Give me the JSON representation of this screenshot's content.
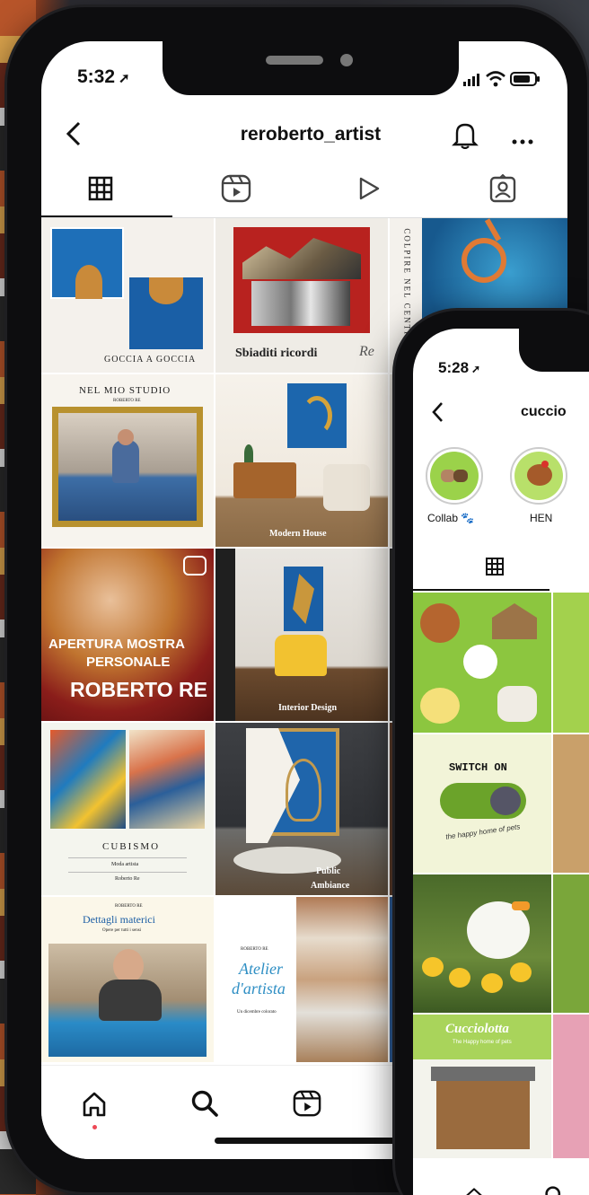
{
  "phone1": {
    "time": "5:32",
    "username": "reroberto_artist",
    "posts": {
      "p1": "GOCCIA A GOCCIA",
      "p2": "Sbiaditi ricordi",
      "p3": "COLPIRE NEL CENTRO",
      "p4_title": "NEL MIO STUDIO",
      "p4_sub": "ROBERTO RE",
      "p5": "Modern House",
      "p7_line1": "APERTURA MOSTRA",
      "p7_line2": "PERSONALE",
      "p7_line3": "ROBERTO RE",
      "p8": "Interior Design",
      "p10_title": "CUBISMO",
      "p10_sub1": "Moda artista",
      "p10_sub2": "Roberto Re",
      "p11_line1": "Public",
      "p11_line2": "Ambiance",
      "p13_top": "ROBERTO RE",
      "p13_title": "Dettagli materici",
      "p13_sub": "Opere per tutti i sensi",
      "p14_top": "ROBERTO RE",
      "p14_line1": "Atelier",
      "p14_line2": "d'artista",
      "p14_sub": "Un dicembre colorato"
    }
  },
  "phone2": {
    "time": "5:28",
    "username": "cuccio",
    "highlights": [
      "Collab 🐾",
      "HEN"
    ],
    "posts": {
      "switch": "SWITCH ON",
      "tagline": "the happy home of pets",
      "brand": "Cucciolotta",
      "brand_sub": "The Happy home of pets"
    }
  },
  "colors": {
    "accent_red": "#ed4956",
    "green": "#8cc63f",
    "blue": "#1e6fb8"
  },
  "icons": [
    "back-icon",
    "bell-icon",
    "more-icon",
    "grid-icon",
    "reels-icon",
    "play-icon",
    "tagged-icon",
    "home-icon",
    "search-icon",
    "signal-icon",
    "wifi-icon",
    "battery-icon"
  ]
}
